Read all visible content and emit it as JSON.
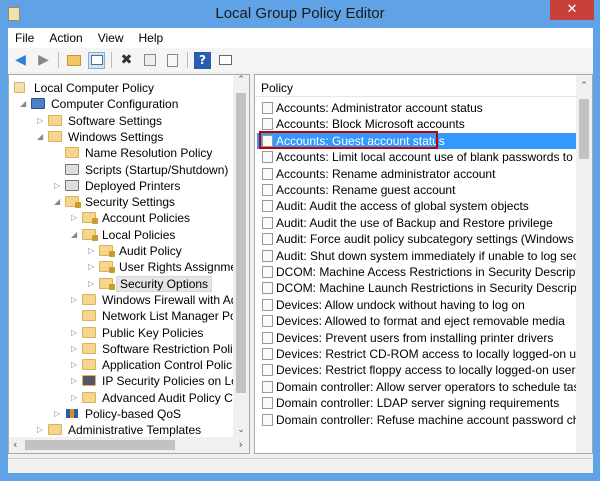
{
  "window": {
    "title": "Local Group Policy Editor",
    "close_glyph": "✕"
  },
  "menu": [
    "File",
    "Action",
    "View",
    "Help"
  ],
  "toolbar": [
    "back-icon",
    "forward-icon",
    "up-folder-icon",
    "show-hide-tree-icon",
    "delete-icon",
    "properties-icon",
    "export-list-icon",
    "help-icon",
    "show-hide-action-pane-icon"
  ],
  "tree": [
    {
      "label": "Local Computer Policy",
      "level": 0,
      "arrow": "",
      "icon": "policy"
    },
    {
      "label": "Computer Configuration",
      "level": 1,
      "arrow": "expanded",
      "icon": "computer"
    },
    {
      "label": "Software Settings",
      "level": 2,
      "arrow": "collapsed",
      "icon": "folder"
    },
    {
      "label": "Windows Settings",
      "level": 2,
      "arrow": "expanded",
      "icon": "folder"
    },
    {
      "label": "Name Resolution Policy",
      "level": 3,
      "arrow": "",
      "icon": "folder"
    },
    {
      "label": "Scripts (Startup/Shutdown)",
      "level": 3,
      "arrow": "",
      "icon": "script"
    },
    {
      "label": "Deployed Printers",
      "level": 3,
      "arrow": "collapsed",
      "icon": "printer"
    },
    {
      "label": "Security Settings",
      "level": 3,
      "arrow": "expanded",
      "icon": "lockfolder"
    },
    {
      "label": "Account Policies",
      "level": 4,
      "arrow": "collapsed",
      "icon": "lockfolder"
    },
    {
      "label": "Local Policies",
      "level": 4,
      "arrow": "expanded",
      "icon": "lockfolder"
    },
    {
      "label": "Audit Policy",
      "level": 5,
      "arrow": "collapsed",
      "icon": "lockfolder"
    },
    {
      "label": "User Rights Assignment",
      "level": 5,
      "arrow": "collapsed",
      "icon": "lockfolder"
    },
    {
      "label": "Security Options",
      "level": 5,
      "arrow": "collapsed",
      "icon": "lockfolder",
      "selected": true
    },
    {
      "label": "Windows Firewall with Adva",
      "level": 4,
      "arrow": "collapsed",
      "icon": "folder"
    },
    {
      "label": "Network List Manager Polici",
      "level": 4,
      "arrow": "",
      "icon": "folder"
    },
    {
      "label": "Public Key Policies",
      "level": 4,
      "arrow": "collapsed",
      "icon": "folder"
    },
    {
      "label": "Software Restriction Policies",
      "level": 4,
      "arrow": "collapsed",
      "icon": "folder"
    },
    {
      "label": "Application Control Policies",
      "level": 4,
      "arrow": "collapsed",
      "icon": "folder"
    },
    {
      "label": "IP Security Policies on Local",
      "level": 4,
      "arrow": "collapsed",
      "icon": "ipsec"
    },
    {
      "label": "Advanced Audit Policy Conf",
      "level": 4,
      "arrow": "collapsed",
      "icon": "folder"
    },
    {
      "label": "Policy-based QoS",
      "level": 3,
      "arrow": "collapsed",
      "icon": "chart"
    },
    {
      "label": "Administrative Templates",
      "level": 2,
      "arrow": "collapsed",
      "icon": "folder"
    }
  ],
  "list": {
    "header": "Policy",
    "items": [
      "Accounts: Administrator account status",
      "Accounts: Block Microsoft accounts",
      "Accounts: Guest account status",
      "Accounts: Limit local account use of blank passwords to co...",
      "Accounts: Rename administrator account",
      "Accounts: Rename guest account",
      "Audit: Audit the access of global system objects",
      "Audit: Audit the use of Backup and Restore privilege",
      "Audit: Force audit policy subcategory settings (Windows Vis...",
      "Audit: Shut down system immediately if unable to log secur...",
      "DCOM: Machine Access Restrictions in Security Descriptor D...",
      "DCOM: Machine Launch Restrictions in Security Descriptor ...",
      "Devices: Allow undock without having to log on",
      "Devices: Allowed to format and eject removable media",
      "Devices: Prevent users from installing printer drivers",
      "Devices: Restrict CD-ROM access to locally logged-on user ...",
      "Devices: Restrict floppy access to locally logged-on user only",
      "Domain controller: Allow server operators to schedule tasks",
      "Domain controller: LDAP server signing requirements",
      "Domain controller: Refuse machine account password chan..."
    ],
    "selected_index": 2
  },
  "colors": {
    "accent": "#3399ff",
    "highlight_box": "#c00000",
    "titlebar": "#5fa3e6"
  }
}
